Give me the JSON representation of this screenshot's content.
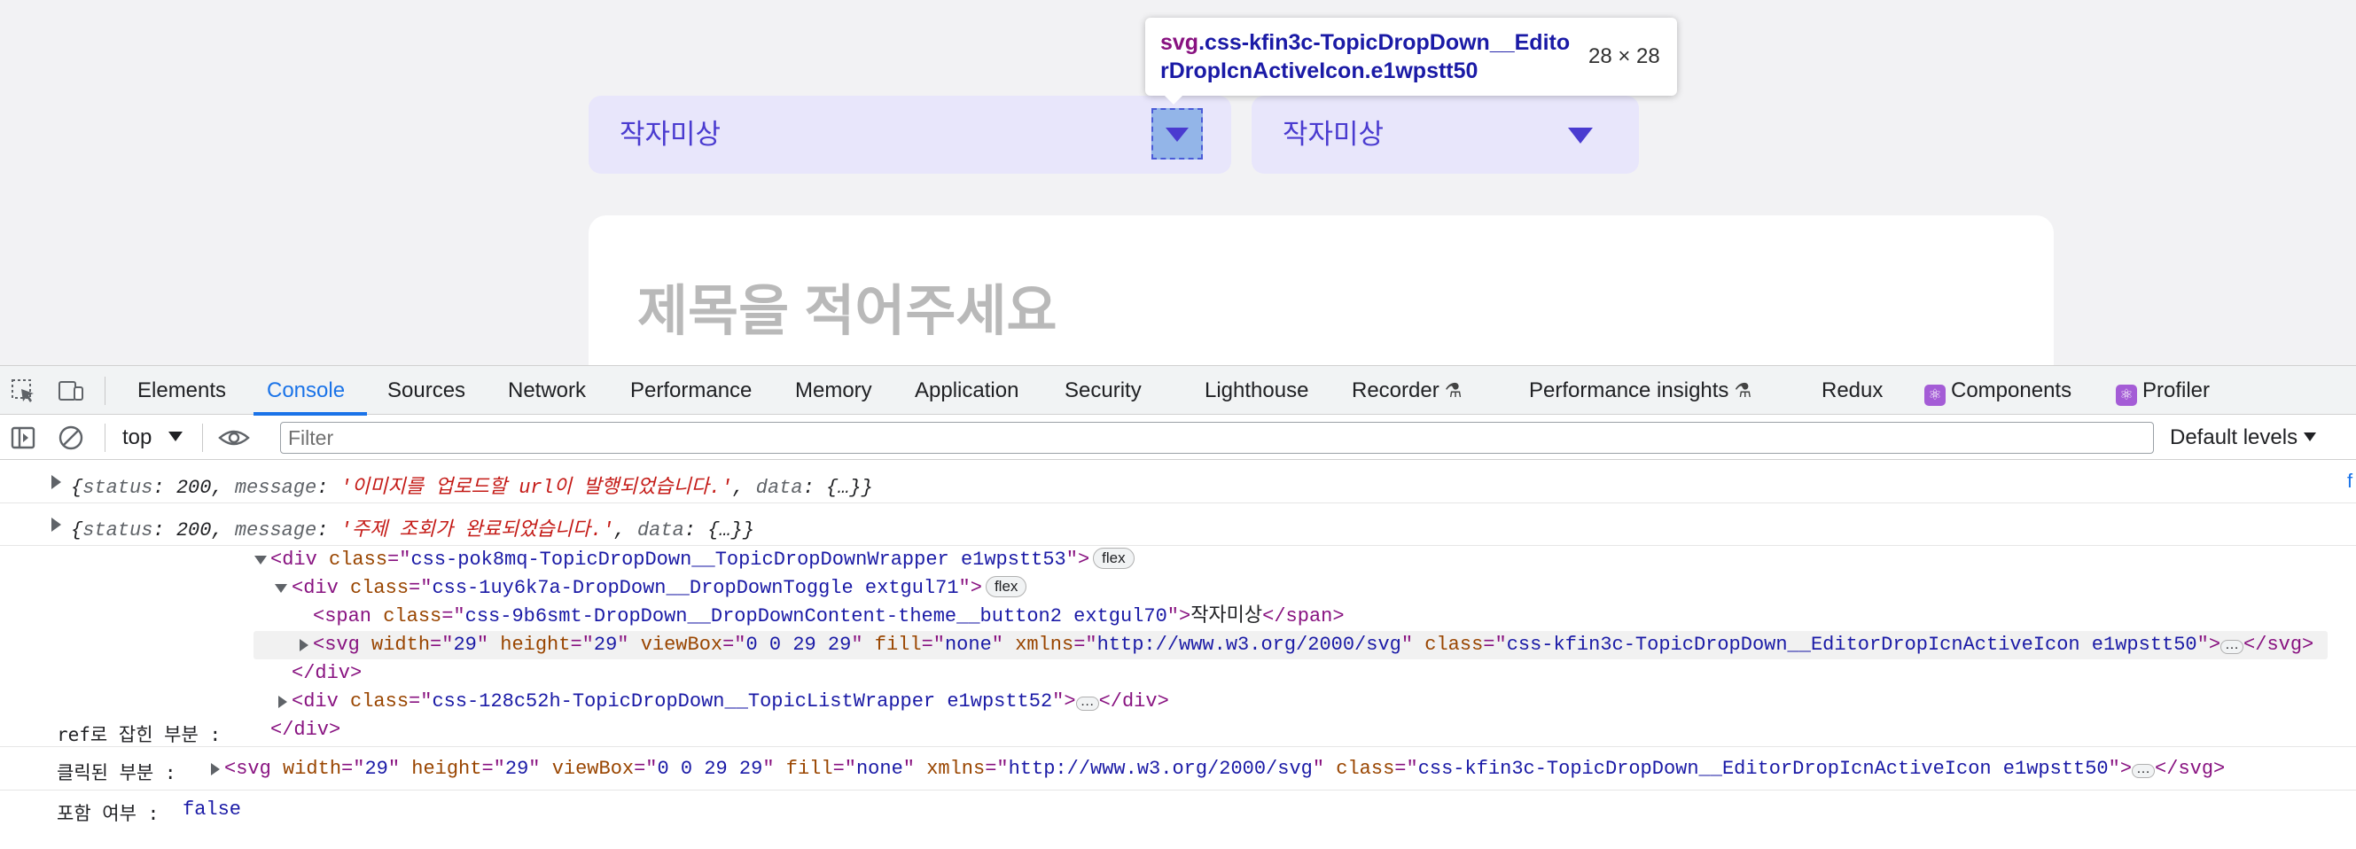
{
  "page": {
    "dropdown1": {
      "label": "작자미상"
    },
    "dropdown2": {
      "label": "작자미상"
    },
    "title_placeholder": "제목을 적어주세요",
    "tooltip": {
      "tag": "svg",
      "selector": ".css-kfin3c-TopicDropDown__EditorDropIcnActiveIcon.e1wpstt50",
      "size": "28 × 28"
    },
    "colors": {
      "accent": "#4a3bd0",
      "dropdown_bg": "#e8e6fb",
      "highlight": "#6f9fe0"
    }
  },
  "devtools": {
    "tabs": [
      {
        "label": "Elements"
      },
      {
        "label": "Console",
        "active": true
      },
      {
        "label": "Sources"
      },
      {
        "label": "Network"
      },
      {
        "label": "Performance"
      },
      {
        "label": "Memory"
      },
      {
        "label": "Application"
      },
      {
        "label": "Security"
      },
      {
        "label": "Lighthouse"
      },
      {
        "label": "Recorder"
      },
      {
        "label": "Performance insights"
      },
      {
        "label": "Redux"
      },
      {
        "label": "Components"
      },
      {
        "label": "Profiler"
      }
    ],
    "toolbar": {
      "context": "top",
      "filter_placeholder": "Filter",
      "levels": "Default levels"
    },
    "logs": [
      {
        "status_key": "status",
        "status_val": "200",
        "message_key": "message",
        "message_val": "'이미지를 업로드할 url이 발행되었습니다.'",
        "data_key": "data",
        "data_val": "{…}"
      },
      {
        "status_key": "status",
        "status_val": "200",
        "message_key": "message",
        "message_val": "'주제 조회가 완료되었습니다.'",
        "data_key": "data",
        "data_val": "{…}"
      }
    ],
    "source_link": "f",
    "tree": {
      "wrapper_class": "css-pok8mq-TopicDropDown__TopicDropDownWrapper e1wpstt53",
      "toggle_class": "css-1uy6k7a-DropDown__DropDownToggle extgul71",
      "span_class": "css-9b6smt-DropDown__DropDownContent-theme__button2 extgul70",
      "span_text": "작자미상",
      "svg_width": "29",
      "svg_height": "29",
      "svg_viewbox": "0 0 29 29",
      "svg_fill": "none",
      "svg_xmlns": "http://www.w3.org/2000/svg",
      "svg_class": "css-kfin3c-TopicDropDown__EditorDropIcnActiveIcon e1wpstt50",
      "list_class": "css-128c52h-TopicDropDown__TopicListWrapper e1wpstt52",
      "flex_badge": "flex",
      "ref_label": "ref로 잡힌 부분 :",
      "clicked_label": "클릭된 부분 :",
      "contains_label": "포함 여부 :",
      "contains_value": "false"
    }
  }
}
